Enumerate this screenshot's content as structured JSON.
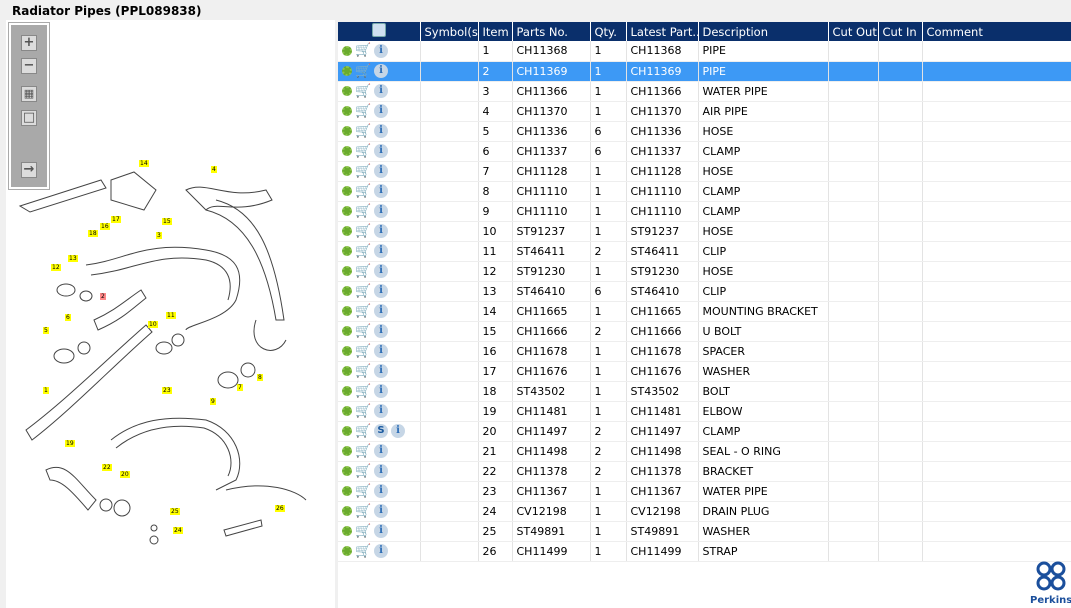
{
  "title": "Radiator Pipes (PPL089838)",
  "toolbar": {
    "zoom_in": "+",
    "zoom_out": "−",
    "fit": "▦",
    "actual": "□",
    "export": "→"
  },
  "columns": [
    "",
    "Symbol(s)",
    "Item",
    "Parts No.",
    "Qty.",
    "Latest Part...",
    "Description",
    "Cut Out",
    "Cut In",
    "Comment"
  ],
  "rows": [
    {
      "item": "1",
      "part": "CH11368",
      "qty": "1",
      "latest": "CH11368",
      "desc": "PIPE"
    },
    {
      "item": "2",
      "part": "CH11369",
      "qty": "1",
      "latest": "CH11369",
      "desc": "PIPE",
      "selected": true
    },
    {
      "item": "3",
      "part": "CH11366",
      "qty": "1",
      "latest": "CH11366",
      "desc": "WATER PIPE"
    },
    {
      "item": "4",
      "part": "CH11370",
      "qty": "1",
      "latest": "CH11370",
      "desc": "AIR PIPE"
    },
    {
      "item": "5",
      "part": "CH11336",
      "qty": "6",
      "latest": "CH11336",
      "desc": "HOSE"
    },
    {
      "item": "6",
      "part": "CH11337",
      "qty": "6",
      "latest": "CH11337",
      "desc": "CLAMP"
    },
    {
      "item": "7",
      "part": "CH11128",
      "qty": "1",
      "latest": "CH11128",
      "desc": "HOSE"
    },
    {
      "item": "8",
      "part": "CH11110",
      "qty": "1",
      "latest": "CH11110",
      "desc": "CLAMP"
    },
    {
      "item": "9",
      "part": "CH11110",
      "qty": "1",
      "latest": "CH11110",
      "desc": "CLAMP"
    },
    {
      "item": "10",
      "part": "ST91237",
      "qty": "1",
      "latest": "ST91237",
      "desc": "HOSE"
    },
    {
      "item": "11",
      "part": "ST46411",
      "qty": "2",
      "latest": "ST46411",
      "desc": "CLIP"
    },
    {
      "item": "12",
      "part": "ST91230",
      "qty": "1",
      "latest": "ST91230",
      "desc": "HOSE"
    },
    {
      "item": "13",
      "part": "ST46410",
      "qty": "6",
      "latest": "ST46410",
      "desc": "CLIP"
    },
    {
      "item": "14",
      "part": "CH11665",
      "qty": "1",
      "latest": "CH11665",
      "desc": "MOUNTING BRACKET"
    },
    {
      "item": "15",
      "part": "CH11666",
      "qty": "2",
      "latest": "CH11666",
      "desc": "U BOLT"
    },
    {
      "item": "16",
      "part": "CH11678",
      "qty": "1",
      "latest": "CH11678",
      "desc": "SPACER"
    },
    {
      "item": "17",
      "part": "CH11676",
      "qty": "1",
      "latest": "CH11676",
      "desc": "WASHER"
    },
    {
      "item": "18",
      "part": "ST43502",
      "qty": "1",
      "latest": "ST43502",
      "desc": "BOLT"
    },
    {
      "item": "19",
      "part": "CH11481",
      "qty": "1",
      "latest": "CH11481",
      "desc": "ELBOW"
    },
    {
      "item": "20",
      "part": "CH11497",
      "qty": "2",
      "latest": "CH11497",
      "desc": "CLAMP",
      "symbol": "S"
    },
    {
      "item": "21",
      "part": "CH11498",
      "qty": "2",
      "latest": "CH11498",
      "desc": "SEAL - O RING"
    },
    {
      "item": "22",
      "part": "CH11378",
      "qty": "2",
      "latest": "CH11378",
      "desc": "BRACKET"
    },
    {
      "item": "23",
      "part": "CH11367",
      "qty": "1",
      "latest": "CH11367",
      "desc": "WATER PIPE"
    },
    {
      "item": "24",
      "part": "CV12198",
      "qty": "1",
      "latest": "CV12198",
      "desc": "DRAIN PLUG"
    },
    {
      "item": "25",
      "part": "ST49891",
      "qty": "1",
      "latest": "ST49891",
      "desc": "WASHER"
    },
    {
      "item": "26",
      "part": "CH11499",
      "qty": "1",
      "latest": "CH11499",
      "desc": "STRAP"
    }
  ],
  "callouts": [
    "14",
    "4",
    "17",
    "15",
    "16",
    "18",
    "3",
    "13",
    "12",
    "2",
    "6",
    "11",
    "10",
    "5",
    "8",
    "7",
    "9",
    "1",
    "23",
    "19",
    "22",
    "20",
    "25",
    "24",
    "26"
  ],
  "logo": "Perkins",
  "colors": {
    "header": "#0a2f6b",
    "selected": "#3d99f5",
    "callout": "#ffff00"
  }
}
